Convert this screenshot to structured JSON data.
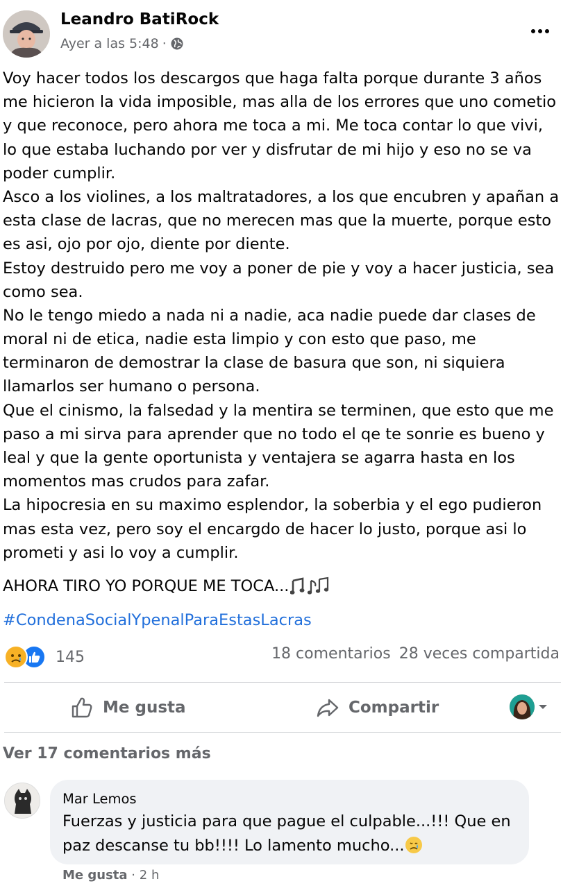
{
  "post": {
    "author": "Leandro BatiRock",
    "time": "Ayer a las 5:48",
    "separator": "·",
    "body_lines": [
      "Voy hacer todos los descargos que haga falta porque durante 3 años",
      "me hicieron la vida imposible, mas alla de los errores que uno cometio",
      "y que reconoce, pero ahora me toca a mi. Me toca contar lo que vivi,",
      "lo que estaba luchando por ver y disfrutar de mi hijo y eso no se va",
      "poder cumplir.",
      "Asco a los violines, a los maltratadores, a los que encubren y apañan a",
      "esta clase de lacras, que no merecen mas que la muerte, porque esto",
      "es asi, ojo por ojo, diente por diente.",
      "Estoy destruido pero me voy a poner de pie y voy a hacer justicia, sea",
      "como sea.",
      "No le tengo miedo a nada ni a nadie, aca nadie puede dar clases de",
      "moral ni de etica, nadie esta limpio y con esto que paso, me",
      "terminaron de demostrar la clase de basura que son, ni siquiera",
      "llamarlos ser humano o persona.",
      "Que el cinismo, la falsedad y la mentira se terminen, que esto que me",
      "paso a mi sirva para aprender que no todo el qe te sonrie es bueno y",
      "leal y que la gente oportunista y ventajera se agarra hasta en los",
      "momentos mas crudos para zafar.",
      "La hipocresia en su maximo esplendor, la soberbia y el ego pudieron",
      "mas esta vez, pero soy el encargdo de hacer lo justo, porque asi lo",
      "prometi y asi lo voy a cumplir."
    ],
    "closing_line": "AHORA TIRO YO PORQUE ME TOCA...",
    "closing_icon": "music-notes-icon",
    "hashtag": "#CondenaSocialYpenalParaEstasLacras"
  },
  "engagement": {
    "reaction_icons": [
      "sad-react-icon",
      "like-react-icon"
    ],
    "reaction_count": "145",
    "comments_count": "18 comentarios",
    "shares_count": "28 veces compartida"
  },
  "actions": {
    "like_label": "Me gusta",
    "share_label": "Compartir"
  },
  "comments": {
    "view_more_label": "Ver 17 comentarios más",
    "items": [
      {
        "author": "Mar Lemos",
        "text_lines": [
          "Fuerzas y justicia para que pague el culpable...!!! Que en",
          "paz descanse tu bb!!!! Lo lamento mucho..."
        ],
        "emoji": "sad-tear-emoji",
        "like_label": "Me gusta",
        "separator": "·",
        "time": "2 h"
      }
    ]
  },
  "colors": {
    "text": "#050505",
    "secondary": "#65676b",
    "link": "#216fdb",
    "like_blue": "#1877f2",
    "sad_yellow": "#f7b125",
    "bubble": "#f0f2f5",
    "divider": "#ced0d4"
  }
}
